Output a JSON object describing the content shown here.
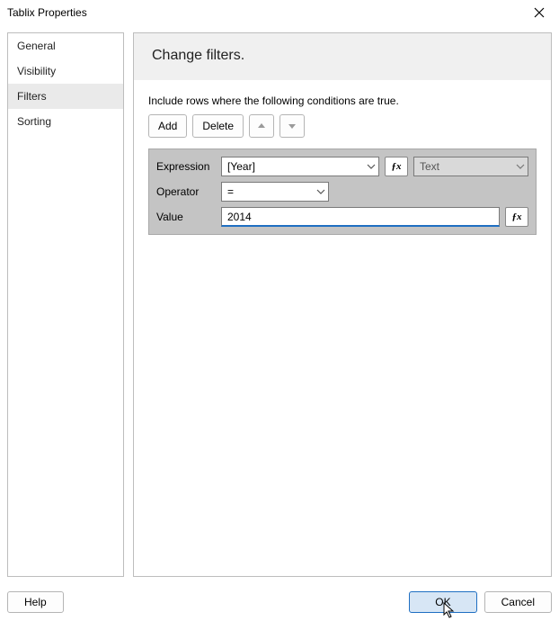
{
  "window": {
    "title": "Tablix Properties"
  },
  "sidebar": {
    "items": [
      {
        "label": "General"
      },
      {
        "label": "Visibility"
      },
      {
        "label": "Filters",
        "selected": true
      },
      {
        "label": "Sorting"
      }
    ]
  },
  "main": {
    "heading": "Change filters.",
    "instruction": "Include rows where the following conditions are true.",
    "toolbar": {
      "add_label": "Add",
      "delete_label": "Delete"
    },
    "filter": {
      "expression_label": "Expression",
      "expression_value": "[Year]",
      "type_value": "Text",
      "operator_label": "Operator",
      "operator_value": "=",
      "value_label": "Value",
      "value_value": "2014"
    }
  },
  "footer": {
    "help_label": "Help",
    "ok_label": "OK",
    "cancel_label": "Cancel"
  }
}
